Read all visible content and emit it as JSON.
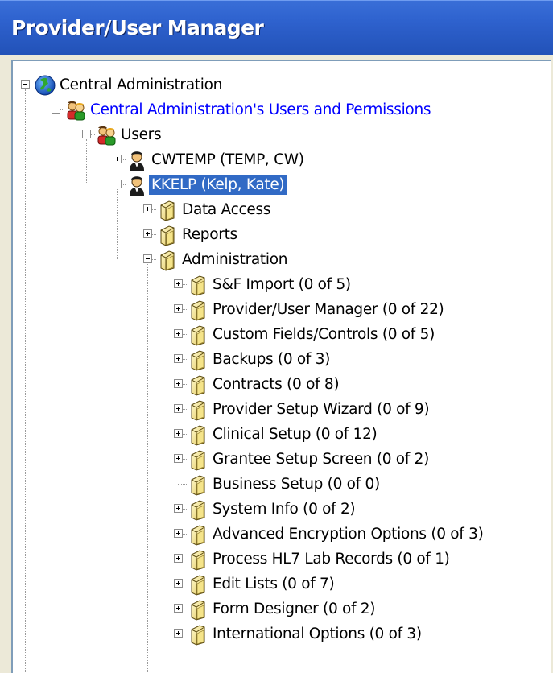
{
  "window": {
    "title": "Provider/User Manager"
  },
  "colors": {
    "title_bar": "#2a5cc6",
    "selection": "#316ac5",
    "link_text": "#0000ff"
  },
  "tree": {
    "root": {
      "label": "Central Administration",
      "icon": "globe-icon",
      "expanded": true
    },
    "permissions_node": {
      "label": "Central Administration's Users and Permissions",
      "icon": "users-group-icon",
      "expanded": true
    },
    "users_node": {
      "label": "Users",
      "icon": "users-group-icon",
      "expanded": true
    },
    "users": [
      {
        "label": "CWTEMP (TEMP, CW)",
        "icon": "user-icon",
        "expanded": false,
        "selected": false
      },
      {
        "label": "KKELP (Kelp, Kate)",
        "icon": "user-icon",
        "expanded": true,
        "selected": true
      }
    ],
    "categories": [
      {
        "label": "Data Access",
        "icon": "folder-icon",
        "expanded": false
      },
      {
        "label": "Reports",
        "icon": "folder-icon",
        "expanded": false
      },
      {
        "label": "Administration",
        "icon": "folder-icon",
        "expanded": true
      }
    ],
    "admin_items": [
      {
        "label": "S&F Import (0 of 5)",
        "has_children": true
      },
      {
        "label": "Provider/User Manager (0 of 22)",
        "has_children": true
      },
      {
        "label": "Custom Fields/Controls (0 of 5)",
        "has_children": true
      },
      {
        "label": "Backups (0 of 3)",
        "has_children": true
      },
      {
        "label": "Contracts (0 of 8)",
        "has_children": true
      },
      {
        "label": "Provider Setup Wizard (0 of 9)",
        "has_children": true
      },
      {
        "label": "Clinical Setup (0 of 12)",
        "has_children": true
      },
      {
        "label": "Grantee Setup Screen (0 of 2)",
        "has_children": true
      },
      {
        "label": "Business Setup (0 of 0)",
        "has_children": false
      },
      {
        "label": "System Info (0 of 2)",
        "has_children": true
      },
      {
        "label": "Advanced Encryption Options (0 of 3)",
        "has_children": true
      },
      {
        "label": "Process HL7 Lab Records (0 of 1)",
        "has_children": true
      },
      {
        "label": "Edit Lists (0 of 7)",
        "has_children": true
      },
      {
        "label": "Form Designer (0 of 2)",
        "has_children": true
      },
      {
        "label": "International Options (0 of 3)",
        "has_children": true
      }
    ]
  }
}
